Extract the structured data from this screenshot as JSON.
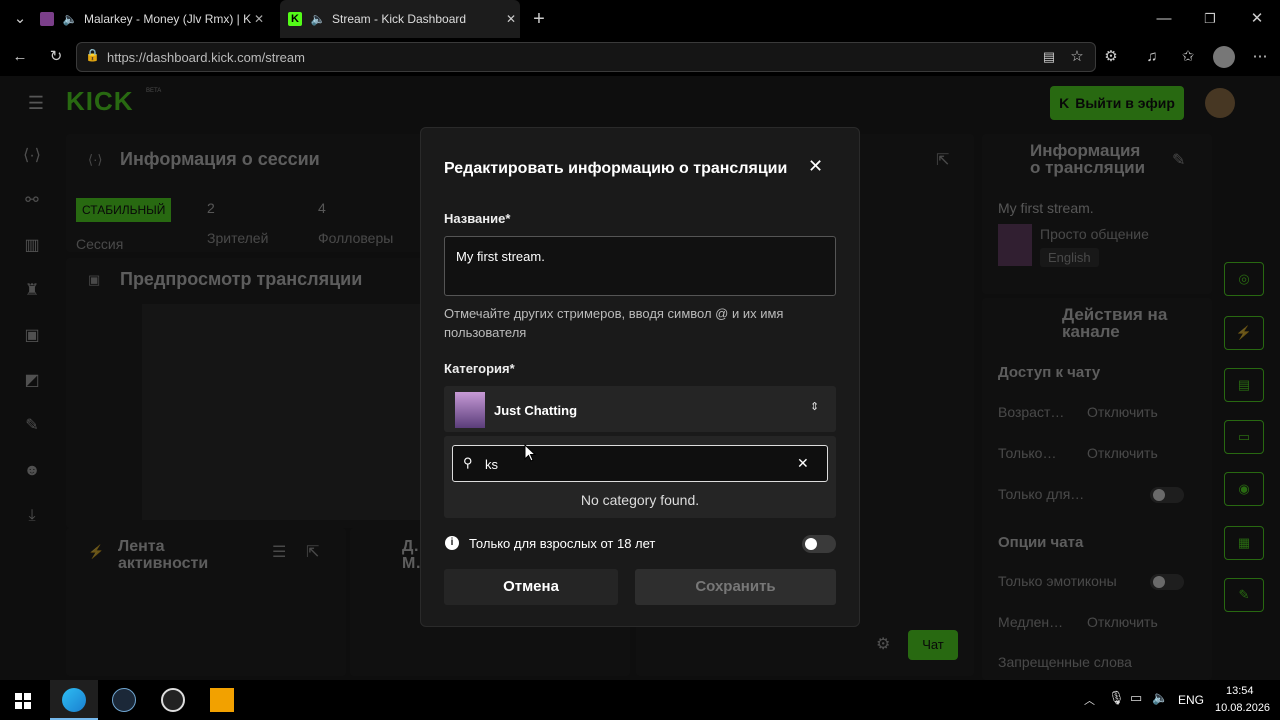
{
  "browser": {
    "tabs": [
      {
        "label": "Malarkey - Money (Jlv Rmx) | K"
      },
      {
        "label": "Stream - Kick Dashboard"
      }
    ],
    "url": "https://dashboard.kick.com/stream"
  },
  "app": {
    "logo": "KICK",
    "logo_badge": "BETA",
    "go_live_label": "Выйти в эфир",
    "session": {
      "title": "Информация о сессии",
      "badge": "СТАБИЛЬНЫЙ",
      "badge_sub": "Сессия",
      "viewers": "2",
      "viewers_label": "Зрителей",
      "followers": "4",
      "followers_label": "Фолловеры"
    },
    "preview_title": "Предпросмотр трансляции",
    "activity_title": "Лента активности",
    "middle_title": "Д… М…",
    "chat_button": "Чат",
    "stream_info": {
      "title": "Информация о трансляции",
      "name": "My first stream.",
      "category": "Просто общение",
      "language": "English"
    },
    "channel_actions": {
      "title": "Действия на канале",
      "chat_access": "Доступ к чату",
      "rows": [
        {
          "label": "Возраст…",
          "value": "Отключить"
        },
        {
          "label": "Только…",
          "value": "Отключить"
        },
        {
          "label": "Только для…",
          "value": ""
        }
      ],
      "chat_options": "Опции чата",
      "rows2": [
        {
          "label": "Только эмотиконы",
          "value": ""
        },
        {
          "label": "Медлен…",
          "value": "Отключить"
        },
        {
          "label": "Запрещенные слова",
          "value": ""
        }
      ]
    }
  },
  "modal": {
    "title": "Редактировать информацию о трансляции",
    "name_label": "Название*",
    "name_value": "My first stream.",
    "hint": "Отмечайте других стримеров, вводя символ @ и их имя пользователя",
    "category_label": "Категория*",
    "category_value": "Just Chatting",
    "search_value": "ks",
    "no_results": "No category found.",
    "adult_label": "Только для взрослых от 18 лет",
    "cancel": "Отмена",
    "save": "Сохранить"
  },
  "taskbar": {
    "lang": "ENG",
    "time": "13:54",
    "date": "10.08.2026"
  },
  "colors": {
    "accent": "#53fc18"
  }
}
